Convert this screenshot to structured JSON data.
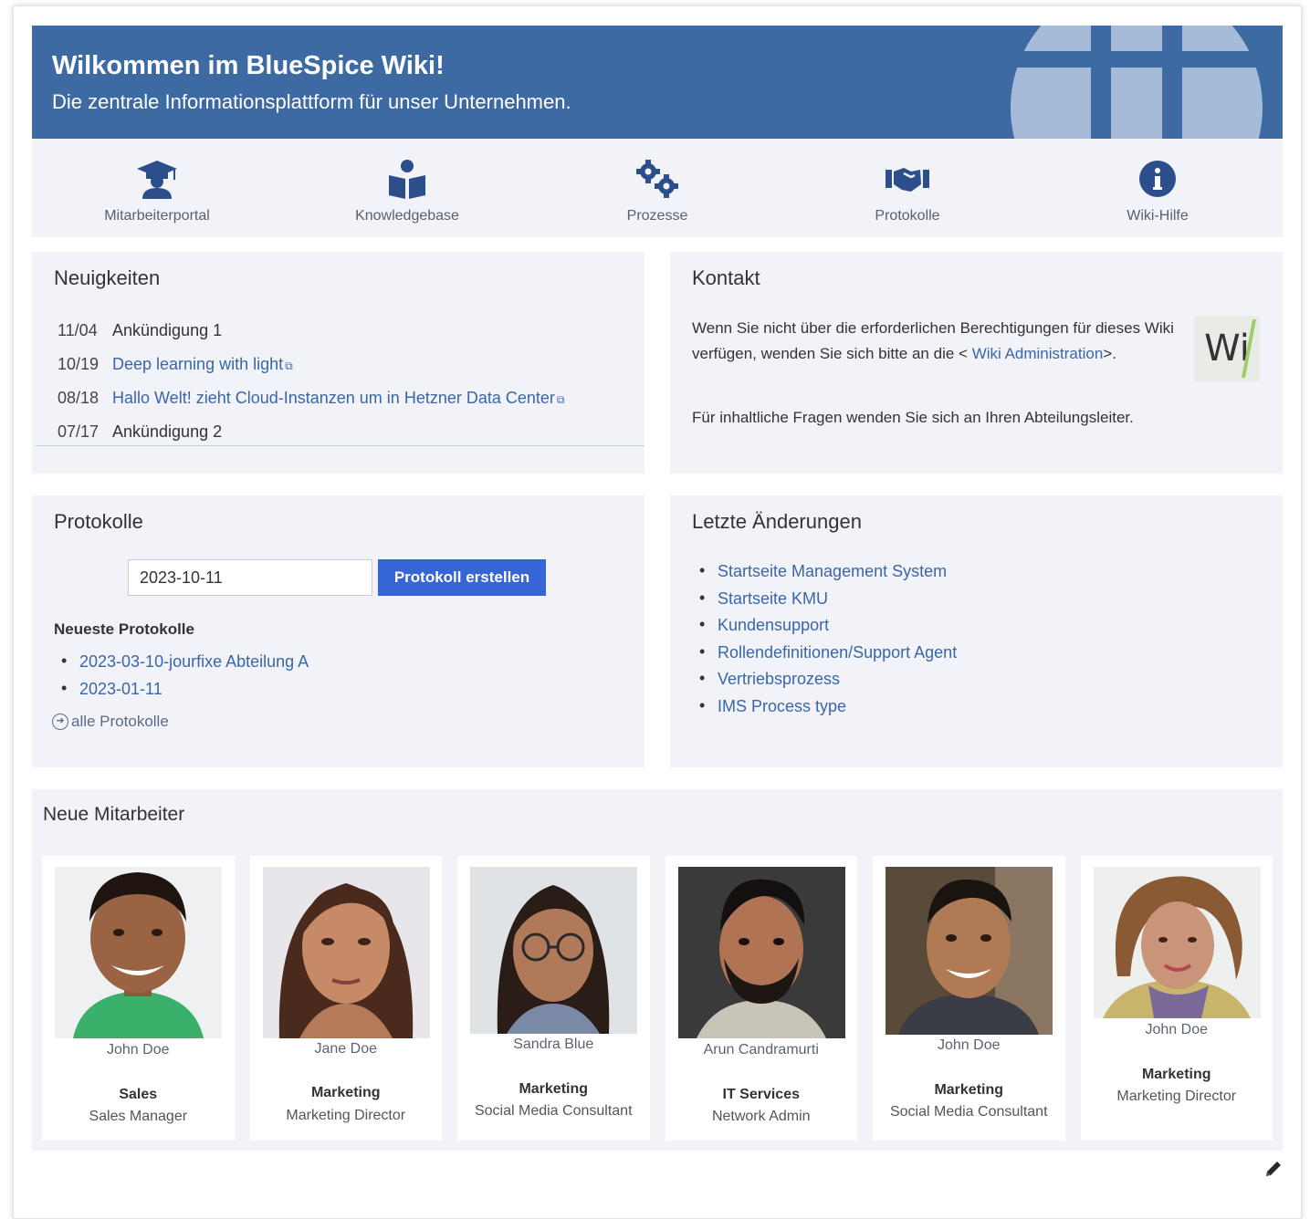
{
  "banner": {
    "title": "Wilkommen im BlueSpice Wiki!",
    "subtitle": "Die zentrale Informationsplattform für unser Unternehmen."
  },
  "quicklinks": [
    {
      "label": "Mitarbeiterportal",
      "icon": "graduation-cap-icon"
    },
    {
      "label": "Knowledgebase",
      "icon": "reader-icon"
    },
    {
      "label": "Prozesse",
      "icon": "cogs-icon"
    },
    {
      "label": "Protokolle",
      "icon": "handshake-icon"
    },
    {
      "label": "Wiki-Hilfe",
      "icon": "info-circle-icon"
    }
  ],
  "news": {
    "title": "Neuigkeiten",
    "items": [
      {
        "date": "11/04",
        "text": "Ankündigung 1",
        "link": false
      },
      {
        "date": "10/19",
        "text": "Deep learning with light",
        "link": true
      },
      {
        "date": "08/18",
        "text": "Hallo Welt! zieht Cloud-Instanzen um in Hetzner Data Center",
        "link": true
      },
      {
        "date": "07/17",
        "text": "Ankündigung 2",
        "link": false
      }
    ]
  },
  "kontakt": {
    "title": "Kontakt",
    "text_before": "Wenn Sie nicht über die erforderlichen Berechtigungen für dieses Wiki verfügen, wenden Sie sich bitte an die < ",
    "link": "Wiki Administration",
    "text_after": ">.",
    "text2": "Für inhaltliche Fragen wenden Sie sich an Ihren Abteilungsleiter.",
    "logo_text": "Wi"
  },
  "protokolle": {
    "title": "Protokolle",
    "date_value": "2023-10-11",
    "button": "Protokoll erstellen",
    "subheading": "Neueste Protokolle",
    "items": [
      "2023-03-10-jourfixe Abteilung A",
      "2023-01-11"
    ],
    "all_link": "alle Protokolle"
  },
  "changes": {
    "title": "Letzte Änderungen",
    "items": [
      "Startseite Management System",
      "Startseite KMU",
      "Kundensupport",
      "Rollendefinitionen/Support Agent",
      "Vertriebsprozess",
      "IMS Process type"
    ]
  },
  "employees": {
    "title": "Neue Mitarbeiter",
    "cards": [
      {
        "name": "John Doe",
        "dept": "Sales",
        "role": "Sales Manager"
      },
      {
        "name": "Jane Doe",
        "dept": "Marketing",
        "role": "Marketing Director"
      },
      {
        "name": "Sandra Blue",
        "dept": "Marketing",
        "role": "Social Media Consultant"
      },
      {
        "name": "Arun Candramurti",
        "dept": "IT Services",
        "role": "Network Admin"
      },
      {
        "name": "John Doe",
        "dept": "Marketing",
        "role": "Social Media Consultant"
      },
      {
        "name": "John Doe",
        "dept": "Marketing",
        "role": "Marketing Director"
      }
    ]
  },
  "colors": {
    "banner": "#3d6aa3",
    "icon": "#2c4f8c",
    "link": "#3a66a8",
    "button": "#3665d6",
    "panel": "#f1f3f8"
  }
}
